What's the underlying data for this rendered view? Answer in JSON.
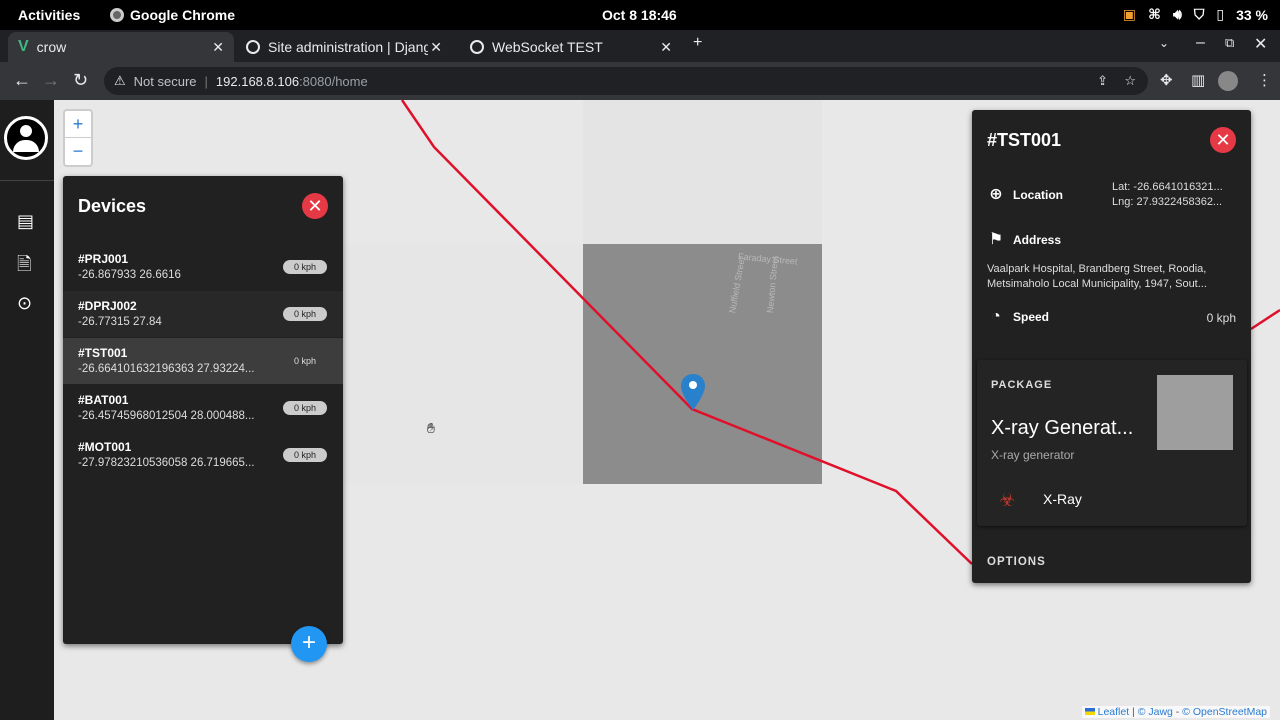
{
  "system": {
    "activities": "Activities",
    "app_name": "Google Chrome",
    "clock": "Oct 8  18:46",
    "battery": "33 %"
  },
  "tabs": [
    {
      "label": "crow",
      "active": true
    },
    {
      "label": "Site administration | Djang",
      "active": false
    },
    {
      "label": "WebSocket TEST",
      "active": false
    }
  ],
  "omnibox": {
    "security": "Not secure",
    "host": "192.168.8.106",
    "path": ":8080/home"
  },
  "map": {
    "zoom_in": "+",
    "zoom_out": "−",
    "streets": [
      "Faraday Street",
      "Nuffield Street",
      "Newton Street"
    ],
    "attribution": {
      "leaflet": "Leaflet",
      "jawg": "© Jawg",
      "osm": "© OpenStreetMap"
    },
    "route_color": "#e0102b"
  },
  "devices_panel": {
    "title": "Devices",
    "items": [
      {
        "id": "#PRJ001",
        "coords": "-26.867933 26.6616",
        "speed": "0 kph"
      },
      {
        "id": "#DPRJ002",
        "coords": "-26.77315 27.84",
        "speed": "0 kph"
      },
      {
        "id": "#TST001",
        "coords": "-26.664101632196363 27.93224...",
        "speed": "0 kph"
      },
      {
        "id": "#BAT001",
        "coords": "-26.45745968012504 28.000488...",
        "speed": "0 kph"
      },
      {
        "id": "#MOT001",
        "coords": "-27.97823210536058 26.719665...",
        "speed": "0 kph"
      }
    ],
    "add": "+"
  },
  "detail_panel": {
    "title": "#TST001",
    "location_label": "Location",
    "lat": "Lat: -26.6641016321...",
    "lng": "Lng: 27.9322458362...",
    "address_label": "Address",
    "address_line1": "Vaalpark Hospital, Brandberg Street, Roodia,",
    "address_line2": "Metsimaholo Local Municipality, 1947, Sout...",
    "speed_label": "Speed",
    "speed_value": "0 kph",
    "package_label": "PACKAGE",
    "package_name": "X-ray Generat...",
    "package_sub": "X-ray generator",
    "hazard_label": "X-Ray",
    "options_label": "OPTIONS"
  },
  "colors": {
    "accent": "#2196f3",
    "danger": "#e63946"
  }
}
